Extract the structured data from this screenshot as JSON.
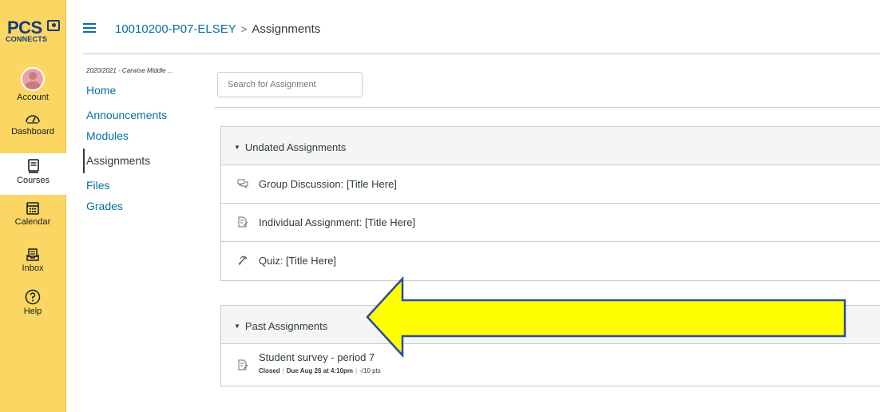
{
  "brand": {
    "line1": "PCS",
    "line2": "CONNECTS"
  },
  "global_nav": [
    {
      "label": "Account",
      "icon": "avatar"
    },
    {
      "label": "Dashboard",
      "icon": "dashboard-icon"
    },
    {
      "label": "Courses",
      "icon": "courses-icon"
    },
    {
      "label": "Calendar",
      "icon": "calendar-icon"
    },
    {
      "label": "Inbox",
      "icon": "inbox-icon"
    },
    {
      "label": "Help",
      "icon": "help-icon"
    }
  ],
  "breadcrumb": {
    "course": "10010200-P07-ELSEY",
    "separator": ">",
    "current": "Assignments"
  },
  "course_nav": {
    "term": "2020/2021 - Carwise Middle ...",
    "items": [
      {
        "label": "Home"
      },
      {
        "label": "Announcements"
      },
      {
        "label": "Modules"
      },
      {
        "label": "Assignments"
      },
      {
        "label": "Files"
      },
      {
        "label": "Grades"
      }
    ]
  },
  "search": {
    "placeholder": "Search for Assignment"
  },
  "groups": [
    {
      "title": "Undated Assignments",
      "items": [
        {
          "title": "Group Discussion: [Title Here]",
          "icon": "discussion-icon"
        },
        {
          "title": "Individual Assignment: [Title Here]",
          "icon": "assignment-icon"
        },
        {
          "title": "Quiz: [Title Here]",
          "icon": "quiz-icon"
        }
      ]
    },
    {
      "title": "Past Assignments",
      "items": [
        {
          "title": "Student survey - period 7",
          "icon": "assignment-icon",
          "status": "Closed",
          "due": "Due Aug 26 at 4:10pm",
          "points": "-/10 pts"
        }
      ]
    }
  ],
  "colors": {
    "nav_bg": "#fbd663",
    "link": "#0770a3",
    "text": "#2d3b45",
    "arrow_fill": "#ffff00",
    "arrow_stroke": "#2f4a9e"
  }
}
